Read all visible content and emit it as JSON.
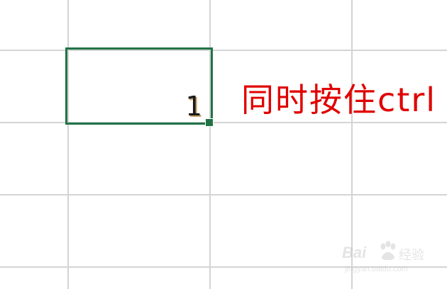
{
  "sheet": {
    "selected_cell_value": "1",
    "annotation_text": "同时按住ctrl",
    "annotation_color": "#e00000",
    "selection_color": "#217346",
    "gridline_color": "#d4d4d4"
  },
  "watermark": {
    "logo_text": "Bai",
    "logo_suffix": "经验",
    "url_text": "jingyan.baidu.com",
    "paw_icon": "baidu-paw-icon"
  }
}
